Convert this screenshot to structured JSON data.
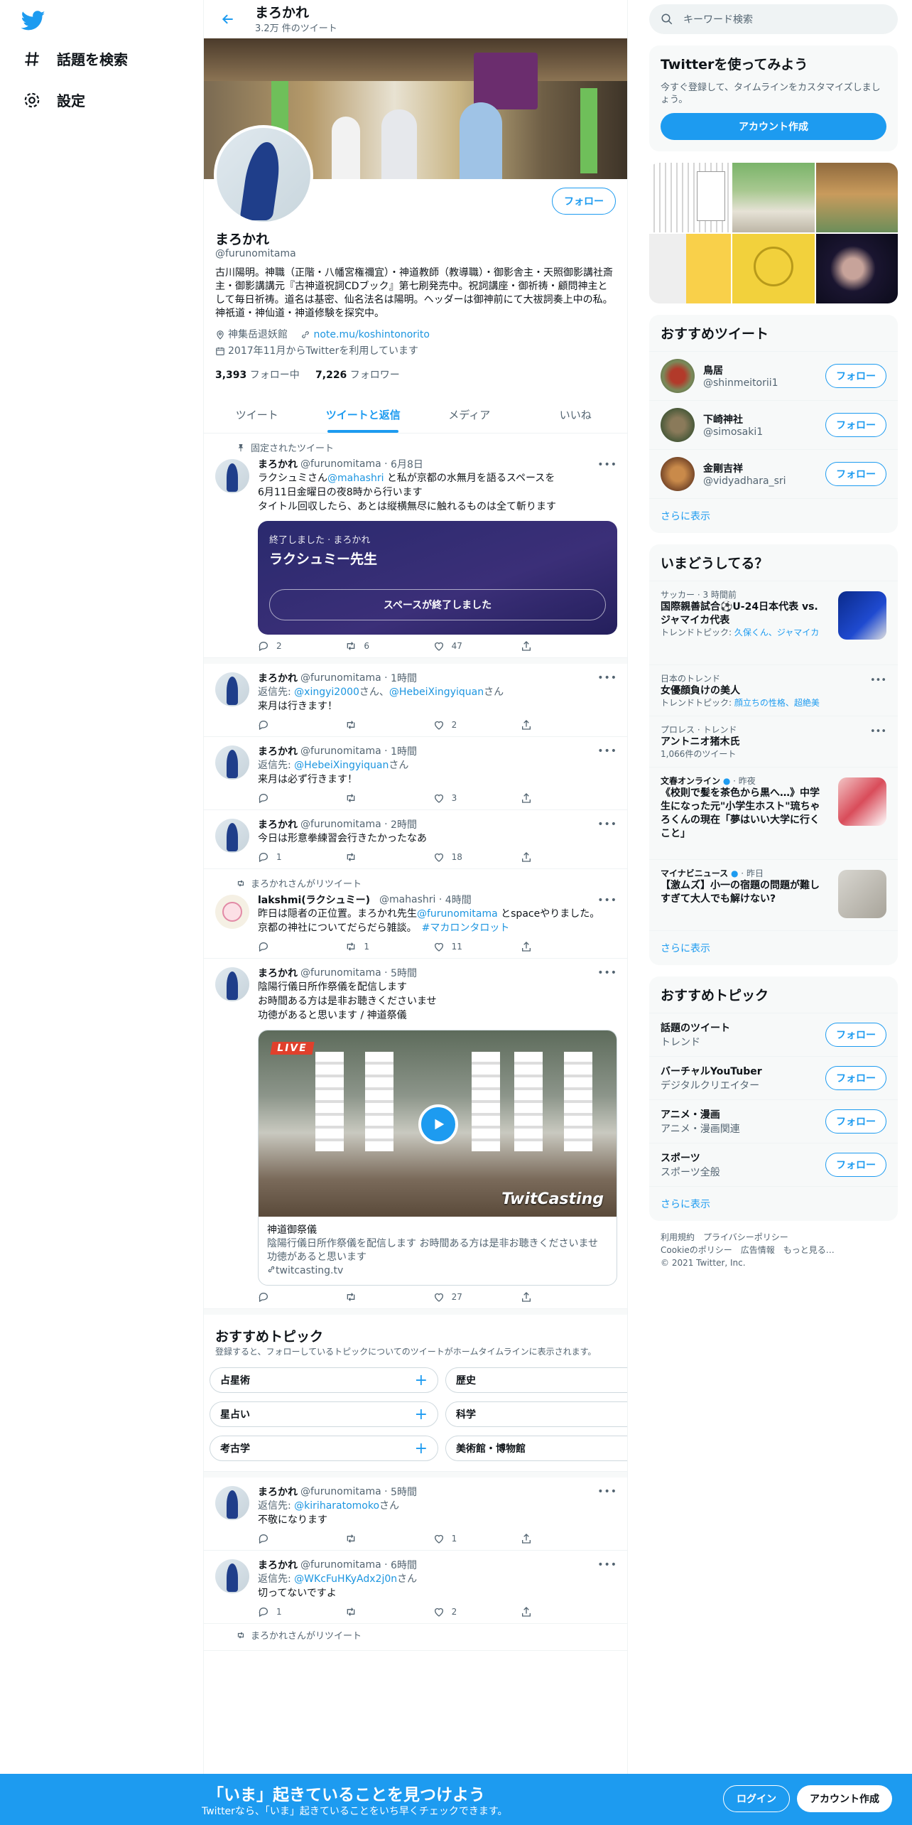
{
  "nav": {
    "explore": "話題を検索",
    "settings": "設定"
  },
  "header": {
    "name": "まろかれ",
    "tweet_count": "3.2万 件のツイート"
  },
  "profile": {
    "follow": "フォロー",
    "name": "まろかれ",
    "handle": "@furunomitama",
    "bio": "古川陽明。神職（正階・八幡宮権禰宜）・神道教師（教導職）・御影舎主・天照御影講社斎主・御影講講元『古神道祝詞CDブック』第七刷発売中。祝詞講座・御祈祷・顧問神主として毎日祈祷。道名は基密、仙名法名は陽明。ヘッダーは御神前にて大祓詞奏上中の私。神祇道・神仙道・神道修験を探究中。",
    "location": "神集岳退妖館",
    "url": "note.mu/koshintonorito",
    "joined": "2017年11月からTwitterを利用しています",
    "following_count": "3,393",
    "following_label": "フォロー中",
    "followers_count": "7,226",
    "followers_label": "フォロワー"
  },
  "tabs": [
    "ツイート",
    "ツイートと返信",
    "メディア",
    "いいね"
  ],
  "pinned_label": "固定されたツイート",
  "tweets": [
    {
      "name": "まろかれ",
      "handle": "@furunomitama",
      "time": "6月8日",
      "line1a": "ラクシュミさん",
      "line1m": "@mahashri",
      "line1b": " と私が京都の水無月を語るスペースを",
      "line2": "6月11日金曜日の夜8時から行います",
      "line3": "タイトル回収したら、あとは縦横無尽に触れるものは全て斬ります",
      "space_status": "終了しました · まろかれ",
      "space_title": "ラクシュミー先生",
      "space_button": "スペースが終了しました",
      "reply": "2",
      "retweet": "6",
      "like": "47"
    },
    {
      "name": "まろかれ",
      "handle": "@furunomitama",
      "time": "1時間",
      "reply_to_label": "返信先: ",
      "reply_to1": "@xingyi2000",
      "reply_mid": "さん、",
      "reply_to2": "@HebeiXingyiquan",
      "reply_end": "さん",
      "text": "来月は行きます！",
      "reply": "",
      "retweet": "",
      "like": "2"
    },
    {
      "name": "まろかれ",
      "handle": "@furunomitama",
      "time": "1時間",
      "reply_to_label": "返信先: ",
      "reply_to1": "@HebeiXingyiquan",
      "reply_end": "さん",
      "text": "来月は必ず行きます！",
      "reply": "",
      "retweet": "",
      "like": "3"
    },
    {
      "name": "まろかれ",
      "handle": "@furunomitama",
      "time": "2時間",
      "text": "今日は形意拳練習会行きたかったなあ",
      "reply": "1",
      "retweet": "",
      "like": "18"
    },
    {
      "rt_label": "まろかれさんがリツイート",
      "name": "lakshmi(ラクシュミー)",
      "handle": "@mahashri",
      "time": "4時間",
      "line1a": "昨日は隠者の正位置。まろかれ先生",
      "line1m": "@furunomitama",
      "line1b": " とspaceやりました。",
      "line2a": "京都の神社についてだらだら雑談。　",
      "line2h": "#マカロンタロット",
      "reply": "",
      "retweet": "1",
      "like": "11"
    },
    {
      "name": "まろかれ",
      "handle": "@furunomitama",
      "time": "5時間",
      "line1": "陰陽行儀日所作祭儀を配信します",
      "line2": "お時間ある方は是非お聴きくださいませ",
      "line3": "功徳があると思います / 神道祭儀",
      "card_live": "LIVE",
      "card_brand": "TwitCasting",
      "card_title": "神道御祭儀",
      "card_desc": "陰陽行儀日所作祭儀を配信します お時間ある方は是非お聴きくださいませ 功徳があると思います",
      "card_domain": "twitcasting.tv",
      "reply": "",
      "retweet": "",
      "like": "27"
    },
    {
      "name": "まろかれ",
      "handle": "@furunomitama",
      "time": "5時間",
      "reply_to_label": "返信先: ",
      "reply_to1": "@kiriharatomoko",
      "reply_end": "さん",
      "text": "不敬になります",
      "reply": "",
      "retweet": "",
      "like": "1"
    },
    {
      "name": "まろかれ",
      "handle": "@furunomitama",
      "time": "6時間",
      "reply_to_label": "返信先: ",
      "reply_to1": "@WKcFuHKyAdx2j0n",
      "reply_end": "さん",
      "text": "切ってないですよ",
      "reply": "1",
      "retweet": "",
      "like": "2"
    }
  ],
  "feed_topics": {
    "title": "おすすめトピック",
    "subtitle": "登録すると、フォローしているトピックについてのツイートがホームタイムラインに表示されます。",
    "items": [
      "占星術",
      "歴史",
      "星占い",
      "科学",
      "考古学",
      "美術館・博物館"
    ]
  },
  "last_rt": "まろかれさんがリツイート",
  "right": {
    "search_placeholder": "キーワード検索",
    "signup_title": "Twitterを使ってみよう",
    "signup_desc": "今すぐ登録して、タイムラインをカスタマイズしましょう。",
    "signup_button": "アカウント作成",
    "rec_title": "おすすめツイート",
    "recs": [
      {
        "name": "鳥居",
        "handle": "@shinmeitorii1"
      },
      {
        "name": "下崎神社",
        "handle": "@simosaki1"
      },
      {
        "name": "金剛吉祥",
        "handle": "@vidyadhara_sri"
      }
    ],
    "follow": "フォロー",
    "show_more": "さらに表示",
    "trends_title": "いまどうしてる？",
    "trends": [
      {
        "meta": "サッカー · 3 時間前",
        "title": "国際親善試合⚽U-24日本代表 vs. ジャマイカ代表",
        "extra_label": "トレンドトピック: ",
        "extra_links": "久保くん、ジャマイカ"
      },
      {
        "meta": "日本のトレンド",
        "title": "女優顔負けの美人",
        "extra_label": "トレンドトピック: ",
        "extra_links": "顔立ちの性格、超絶美"
      },
      {
        "meta": "プロレス · トレンド",
        "title": "アントニオ猪木氏",
        "count": "1,066件のツイート"
      },
      {
        "source": "文春オンライン",
        "time": "昨夜",
        "title": "《校則で髪を茶色から黒へ…》中学生になった元\"小学生ホスト\"琉ちゃろくんの現在「夢はいい大学に行くこと」"
      },
      {
        "source": "マイナビニュース",
        "time": "昨日",
        "title": "【激ムズ】小一の宿題の問題が難しすぎて大人でも解けない?"
      }
    ],
    "topics_title": "おすすめトピック",
    "topics": [
      {
        "name": "話題のツイート",
        "sub": "トレンド"
      },
      {
        "name": "バーチャルYouTuber",
        "sub": "デジタルクリエイター"
      },
      {
        "name": "アニメ・漫画",
        "sub": "アニメ・漫画関連"
      },
      {
        "name": "スポーツ",
        "sub": "スポーツ全般"
      }
    ],
    "footer": {
      "terms": "利用規約",
      "privacy": "プライバシーポリシー",
      "cookie": "Cookieのポリシー",
      "ads": "広告情報",
      "more": "もっと見る…",
      "copy": "© 2021 Twitter, Inc."
    }
  },
  "bottom": {
    "title": "「いま」起きていることを見つけよう",
    "subtitle": "Twitterなら、「いま」起きていることをいち早くチェックできます。",
    "login": "ログイン",
    "signup": "アカウント作成"
  },
  "colors": {
    "accent": "#1d9bf0",
    "space": "#2a2a6e",
    "live": "#e0402c"
  }
}
